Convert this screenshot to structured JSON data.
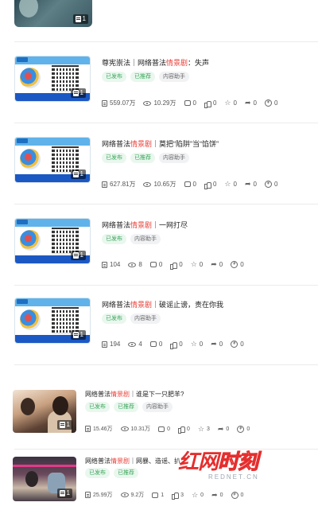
{
  "top_item": {
    "badge_count": "1"
  },
  "items": [
    {
      "title_before": "尊宪崇法｜网络普法",
      "title_hl": "情景剧",
      "title_after": "：失声",
      "tags": [
        "已发布",
        "已推荐",
        "内容助手"
      ],
      "badge": "1",
      "stats": {
        "reads": "559.07万",
        "views": "10.29万",
        "comments": "0",
        "likes": "0",
        "favorites": "0",
        "shares": "0",
        "coins": "0"
      }
    },
    {
      "title_before": "网络普法",
      "title_hl": "情景剧",
      "title_after": "｜莫把“陷阱”当“馅饼”",
      "tags": [
        "已发布",
        "已推荐",
        "内容助手"
      ],
      "badge": "1",
      "stats": {
        "reads": "627.81万",
        "views": "10.65万",
        "comments": "0",
        "likes": "0",
        "favorites": "0",
        "shares": "0",
        "coins": "0"
      }
    },
    {
      "title_before": "网络普法",
      "title_hl": "情景剧",
      "title_after": "｜一网打尽",
      "tags": [
        "已发布",
        "内容助手"
      ],
      "badge": "1",
      "stats": {
        "reads": "104",
        "views": "8",
        "comments": "0",
        "likes": "0",
        "favorites": "0",
        "shares": "0",
        "coins": "0"
      }
    },
    {
      "title_before": "网络普法",
      "title_hl": "情景剧",
      "title_after": "｜破谣止谤，责在你我",
      "tags": [
        "已发布",
        "内容助手"
      ],
      "badge": "1",
      "stats": {
        "reads": "194",
        "views": "4",
        "comments": "0",
        "likes": "0",
        "favorites": "0",
        "shares": "0",
        "coins": "0"
      }
    },
    {
      "title_before": "网络普法",
      "title_hl": "情景剧",
      "title_after": "｜谁是下一只肥羊?",
      "tags": [
        "已发布",
        "已推荐",
        "内容助手"
      ],
      "badge": "1",
      "stats": {
        "reads": "15.46万",
        "views": "10.31万",
        "comments": "0",
        "likes": "0",
        "favorites": "3",
        "shares": "0",
        "coins": "0"
      }
    },
    {
      "title_before": "网络普法",
      "title_hl": "情景剧",
      "title_after": "｜网暴、造谣、扒",
      "tags": [
        "已发布",
        "已推荐"
      ],
      "badge": "1",
      "stats": {
        "reads": "25.99万",
        "views": "9.2万",
        "comments": "1",
        "likes": "3",
        "favorites": "0",
        "shares": "0",
        "coins": "0"
      }
    }
  ],
  "watermark": {
    "text_main_a": "红网",
    "text_main_b": "时刻",
    "text_sub": "REDNET.CN"
  }
}
